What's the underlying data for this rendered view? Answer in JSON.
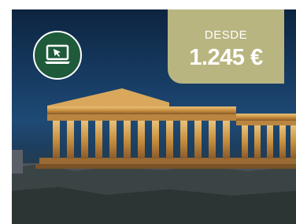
{
  "promo": {
    "icon": "online-computer-icon",
    "price_label": "DESDE",
    "price_value": "1.245 €"
  },
  "colors": {
    "badge_bg": "#1f5a3a",
    "price_bg": "#b8b581",
    "text": "#ffffff"
  }
}
